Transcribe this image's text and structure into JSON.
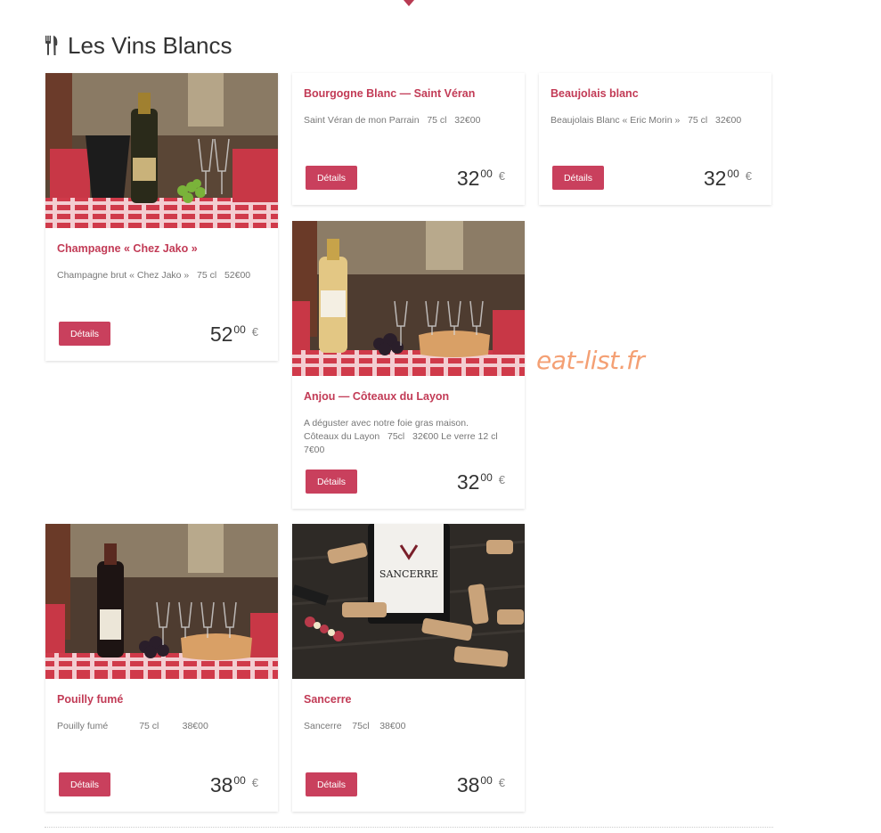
{
  "section": {
    "title": "Les Vins Blancs",
    "icon": "fork-knife-icon"
  },
  "watermark": "eat-list.fr",
  "colors": {
    "accent": "#c23b56",
    "button": "#c9405d",
    "watermark": "#f4a074"
  },
  "cards": [
    {
      "name": "Champagne « Chez Jako »",
      "desc": "Champagne brut « Chez Jako »   75 cl   52€00",
      "button": "Détails",
      "price_int": "52",
      "price_dec": "00",
      "currency": "€"
    },
    {
      "name": "Bourgogne Blanc — Saint Véran",
      "desc": "Saint Véran de mon Parrain   75 cl   32€00",
      "button": "Détails",
      "price_int": "32",
      "price_dec": "00",
      "currency": "€"
    },
    {
      "name": "Beaujolais blanc",
      "desc": "Beaujolais Blanc « Eric Morin »   75 cl   32€00",
      "button": "Détails",
      "price_int": "32",
      "price_dec": "00",
      "currency": "€"
    },
    {
      "name": "Anjou — Côteaux du Layon",
      "desc": "A déguster avec notre foie gras maison.\nCôteaux du Layon   75cl   32€00 Le verre 12 cl   7€00",
      "button": "Détails",
      "price_int": "32",
      "price_dec": "00",
      "currency": "€"
    },
    {
      "name": "Pouilly fumé",
      "desc": "Pouilly fumé            75 cl         38€00",
      "button": "Détails",
      "price_int": "38",
      "price_dec": "00",
      "currency": "€"
    },
    {
      "name": "Sancerre",
      "desc": "Sancerre    75cl    38€00",
      "button": "Détails",
      "price_int": "38",
      "price_dec": "00",
      "currency": "€"
    }
  ],
  "photo_labels": {
    "sancerre_label": "SANCERRE"
  }
}
